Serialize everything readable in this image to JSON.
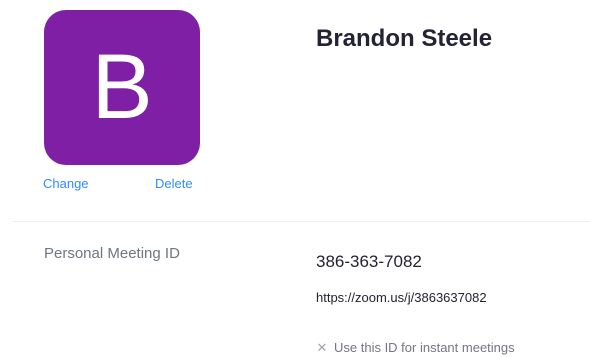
{
  "profile": {
    "avatar_letter": "B",
    "avatar_color": "#7e1fa5",
    "change_label": "Change",
    "delete_label": "Delete",
    "name": "Brandon Steele"
  },
  "meeting": {
    "label": "Personal Meeting ID",
    "id": "386-363-7082",
    "url": "https://zoom.us/j/3863637082",
    "instant_icon": "x-icon",
    "instant_label": "Use this ID for instant meetings"
  },
  "colors": {
    "link": "#2d8cff"
  }
}
